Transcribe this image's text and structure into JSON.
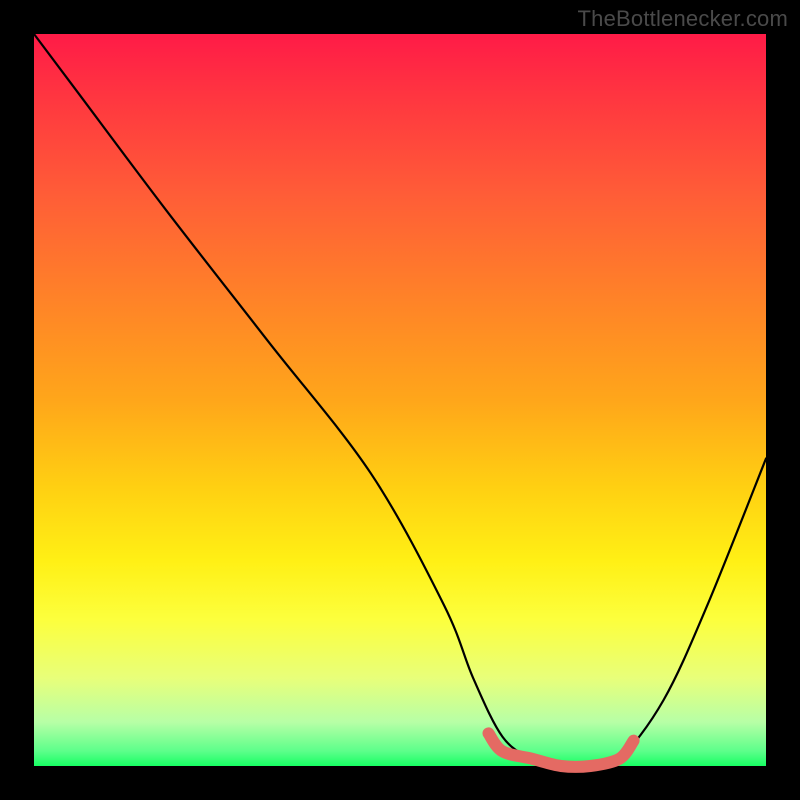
{
  "attribution": "TheBottlenecker.com",
  "chart_data": {
    "type": "line",
    "title": "",
    "xlabel": "",
    "ylabel": "",
    "xlim": [
      0,
      100
    ],
    "ylim": [
      0,
      100
    ],
    "series": [
      {
        "name": "bottleneck-curve",
        "x": [
          0,
          6,
          18,
          32,
          46,
          56,
          60,
          64,
          68,
          72,
          76,
          80,
          86,
          92,
          100
        ],
        "y": [
          100,
          92,
          76,
          58,
          40,
          22,
          12,
          4,
          1,
          0,
          0,
          1,
          9,
          22,
          42
        ]
      }
    ],
    "highlight": {
      "name": "optimal-range",
      "x_start": 62,
      "x_end": 82,
      "color": "#e46a63"
    },
    "gradient_stops": [
      {
        "pos": 0,
        "color": "#ff1b47"
      },
      {
        "pos": 50,
        "color": "#ffa61a"
      },
      {
        "pos": 80,
        "color": "#fcff3d"
      },
      {
        "pos": 100,
        "color": "#17ff63"
      }
    ]
  }
}
